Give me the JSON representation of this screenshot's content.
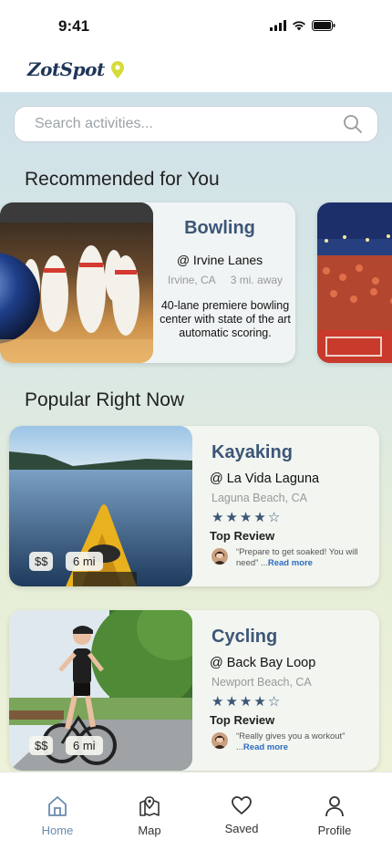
{
  "status_bar": {
    "time": "9:41"
  },
  "header": {
    "logo_text": "ZotSpot",
    "logo_icon": "map-pin-icon"
  },
  "search": {
    "placeholder": "Search activities...",
    "value": ""
  },
  "sections": {
    "recommended_title": "Recommended for You",
    "popular_title": "Popular Right Now"
  },
  "recommended": [
    {
      "title": "Bowling",
      "venue": "@ Irvine Lanes",
      "city": "Irvine, CA",
      "distance": "3 mi. away",
      "description": "40-lane premiere bowling center with state of the art automatic scoring."
    }
  ],
  "popular": [
    {
      "title": "Kayaking",
      "venue": "@ La Vida Laguna",
      "location": "Laguna Beach, CA",
      "rating": 4,
      "rating_max": 5,
      "review_label": "Top Review",
      "review_text": "“Prepare to get soaked! You will need” ...",
      "read_more": "Read more",
      "price": "$$",
      "distance": "6 mi"
    },
    {
      "title": "Cycling",
      "venue": "@ Back Bay Loop",
      "location": "Newport Beach, CA",
      "rating": 4,
      "rating_max": 5,
      "review_label": "Top Review",
      "review_text": "“Really gives you a workout” ...",
      "read_more": "Read more",
      "price": "$$",
      "distance": "6 mi"
    }
  ],
  "nav": [
    {
      "label": "Home",
      "icon": "home-icon",
      "active": true
    },
    {
      "label": "Map",
      "icon": "map-icon",
      "active": false
    },
    {
      "label": "Saved",
      "icon": "heart-icon",
      "active": false
    },
    {
      "label": "Profile",
      "icon": "user-icon",
      "active": false
    }
  ],
  "colors": {
    "accent": "#3c5677",
    "nav_active": "#6a8ab0",
    "link": "#2d6cc0",
    "logo_pin": "#d6dc3a"
  }
}
